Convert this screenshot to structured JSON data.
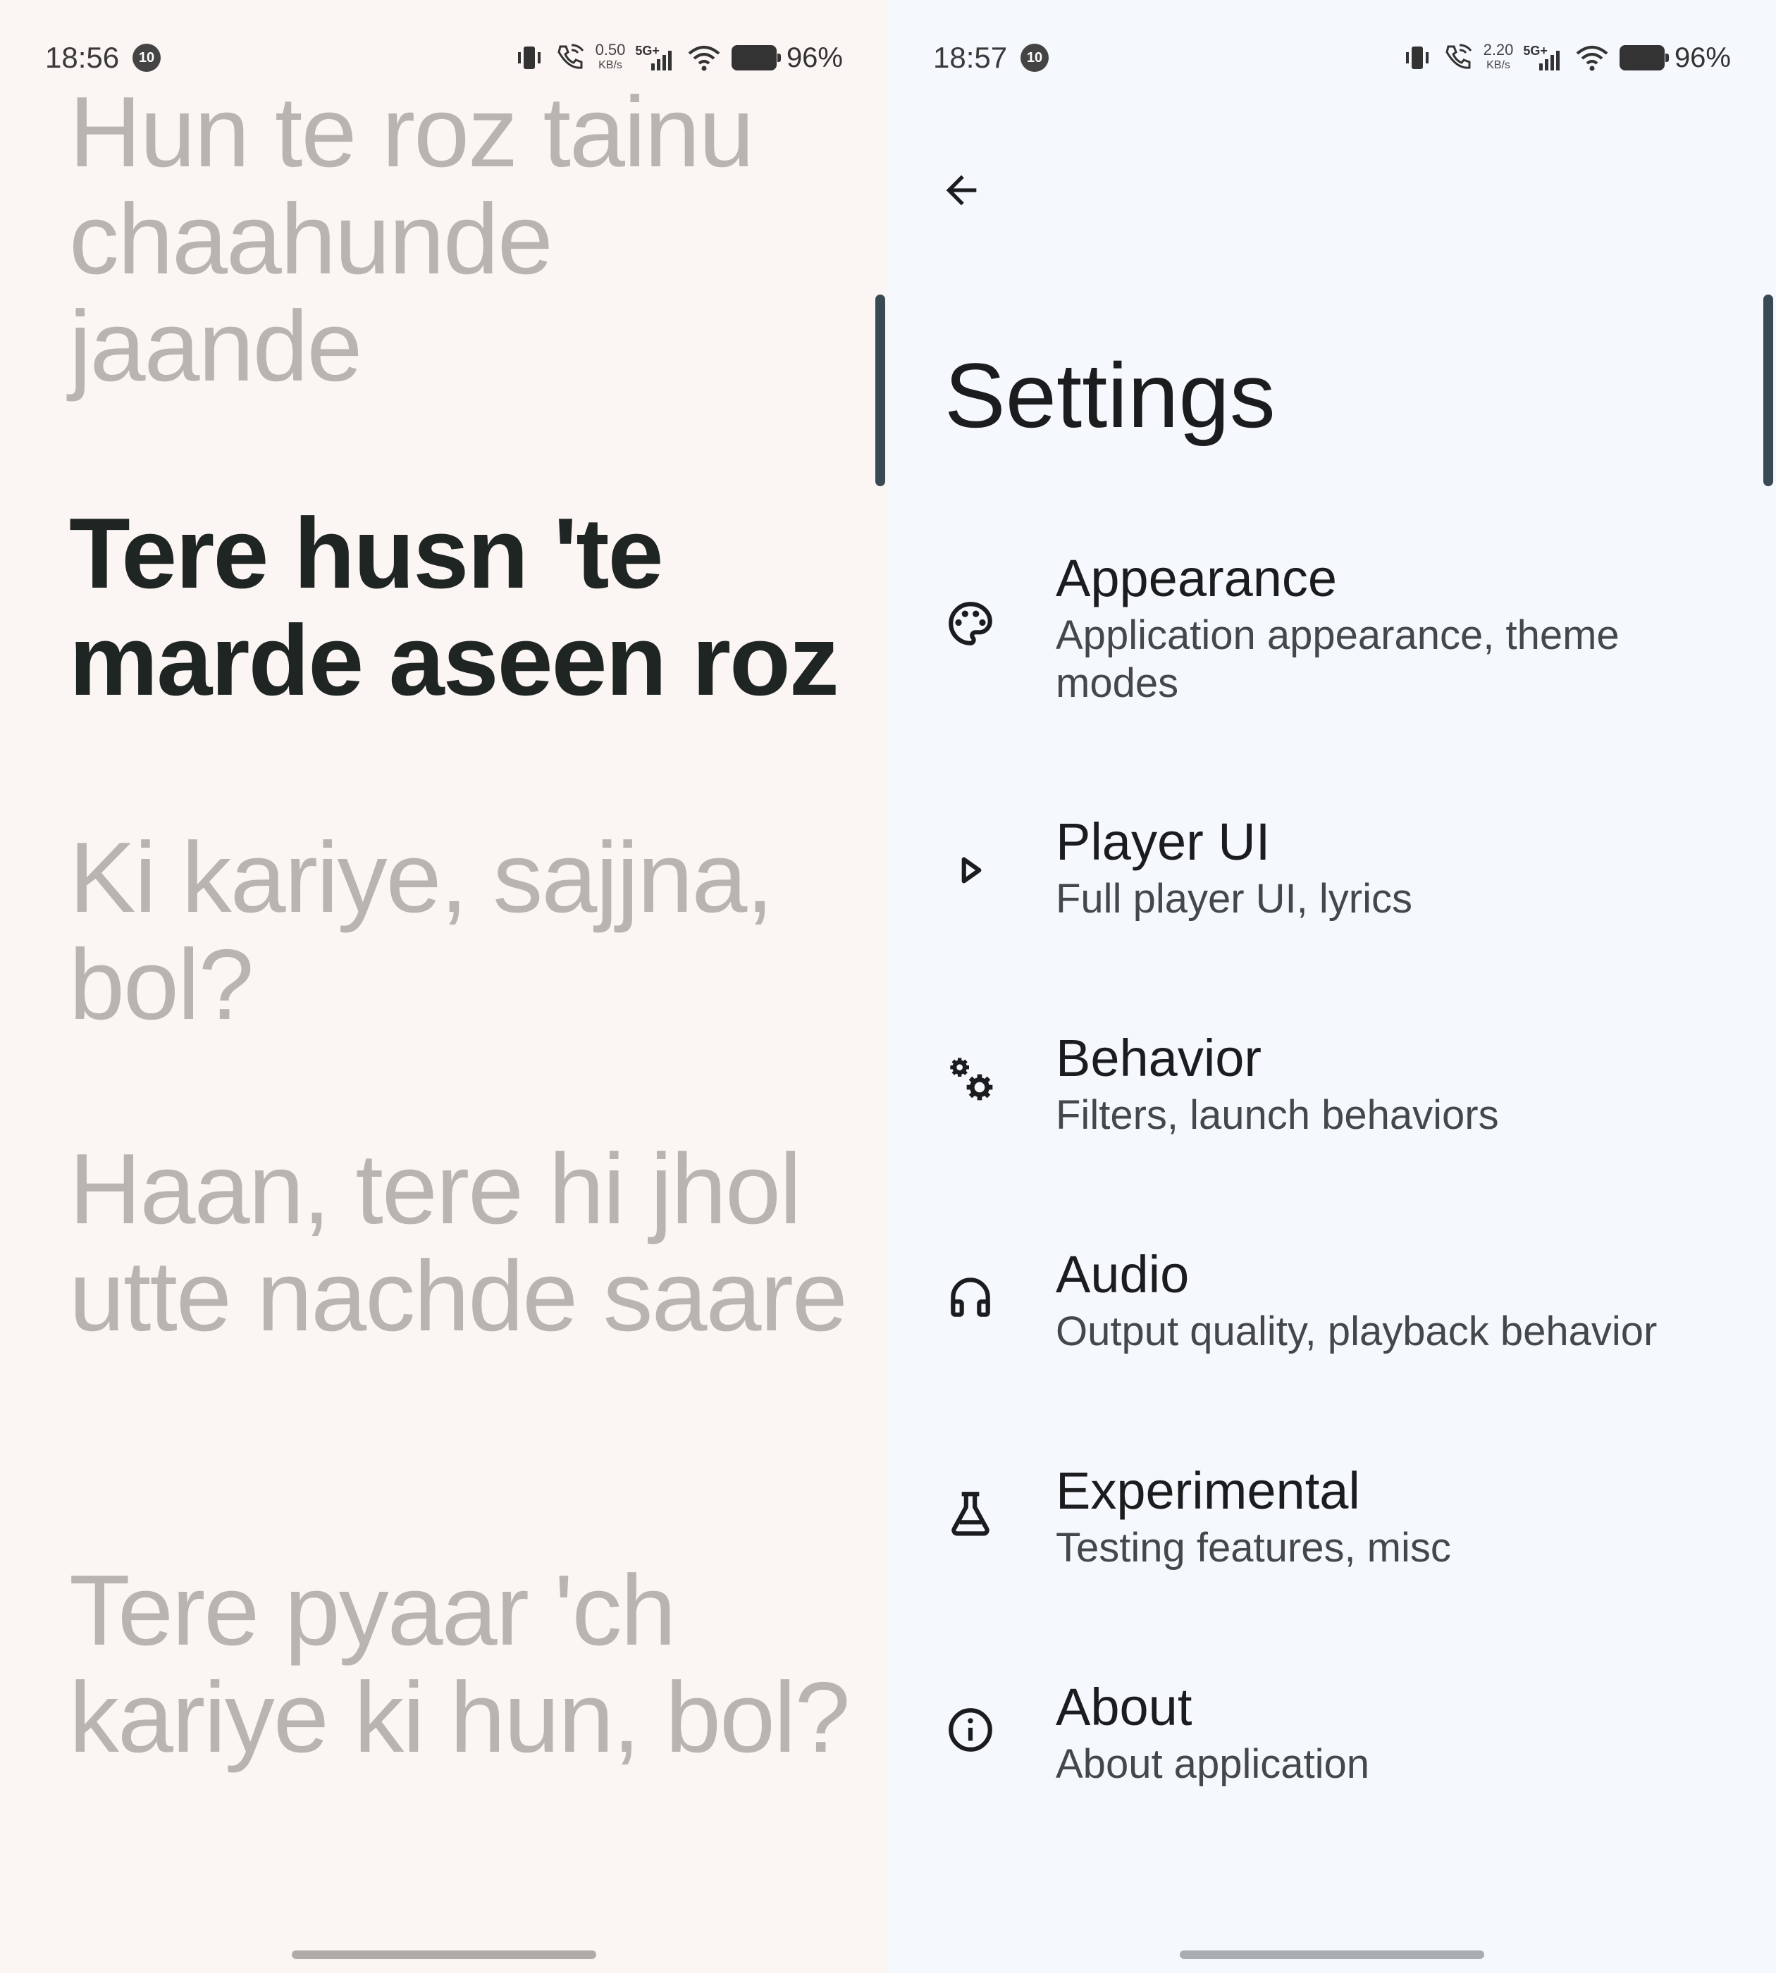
{
  "left_screen": {
    "status_bar": {
      "time": "18:56",
      "notification_badge": "10",
      "net_speed_value": "0.50",
      "net_speed_unit": "KB/s",
      "network_type": "5G+",
      "battery_percent": "96%"
    },
    "lyrics": [
      {
        "text": "Hun te roz tainu chaahunde jaande",
        "active": false
      },
      {
        "text": "Tere husn 'te marde aseen roz",
        "active": true
      },
      {
        "text": "Ki kariye, sajjna, bol?",
        "active": false
      },
      {
        "text": "Haan, tere hi jhol utte nachde saare",
        "active": false
      },
      {
        "text": "Tere pyaar 'ch kariye ki hun, bol?",
        "active": false
      }
    ]
  },
  "right_screen": {
    "status_bar": {
      "time": "18:57",
      "notification_badge": "10",
      "net_speed_value": "2.20",
      "net_speed_unit": "KB/s",
      "network_type": "5G+",
      "battery_percent": "96%"
    },
    "back_icon": "arrow-back-icon",
    "title": "Settings",
    "items": [
      {
        "icon": "palette-icon",
        "label": "Appearance",
        "sub": "Application appearance, theme modes"
      },
      {
        "icon": "play-icon",
        "label": "Player UI",
        "sub": "Full player UI, lyrics"
      },
      {
        "icon": "gears-icon",
        "label": "Behavior",
        "sub": "Filters, launch behaviors"
      },
      {
        "icon": "headphones-icon",
        "label": "Audio",
        "sub": "Output quality, playback behavior"
      },
      {
        "icon": "flask-icon",
        "label": "Experimental",
        "sub": "Testing features, misc"
      },
      {
        "icon": "info-icon",
        "label": "About",
        "sub": "About application"
      }
    ]
  },
  "colors": {
    "left_background": "#fbf5f3",
    "right_background": "#f5f8fc",
    "lyric_active": "#1e2523",
    "lyric_inactive": "#b8b4b2"
  }
}
